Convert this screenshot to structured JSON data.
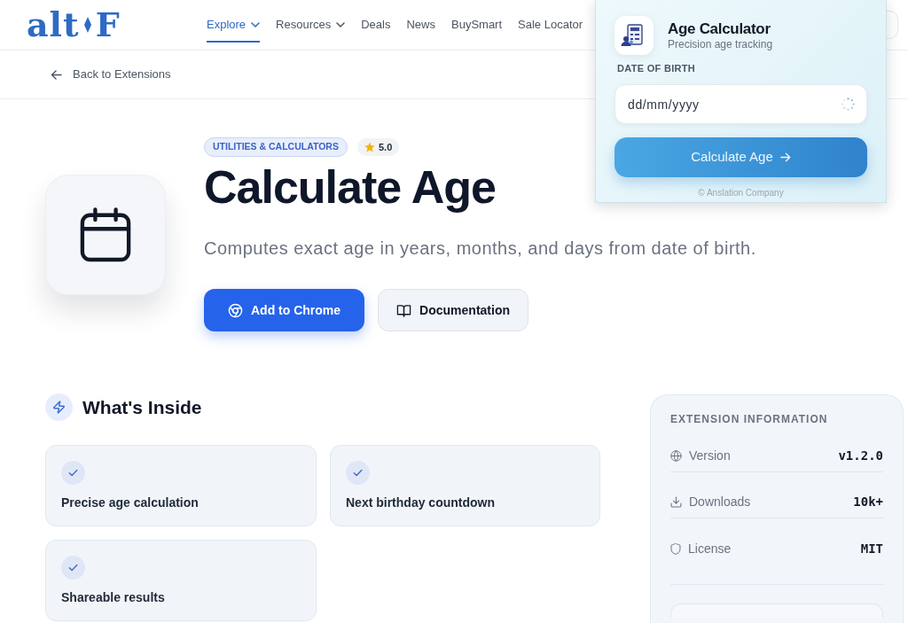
{
  "navbar": {
    "logo": {
      "left": "alt",
      "right": "F"
    },
    "links": [
      {
        "label": "Explore",
        "selected": true,
        "dropdown": true
      },
      {
        "label": "Resources",
        "selected": false,
        "dropdown": true
      },
      {
        "label": "Deals",
        "selected": false,
        "dropdown": false
      },
      {
        "label": "News",
        "selected": false,
        "dropdown": false
      },
      {
        "label": "BuySmart",
        "selected": false,
        "dropdown": false
      },
      {
        "label": "Sale Locator",
        "selected": false,
        "dropdown": false
      }
    ]
  },
  "back_link": "Back to Extensions",
  "extension": {
    "category": "UTILITIES & CALCULATORS",
    "rating": "5.0",
    "title": "Calculate Age",
    "description": "Computes exact age in years, months, and days from date of birth.",
    "buttons": [
      {
        "label": "Add to Chrome",
        "kind": "primary"
      },
      {
        "label": "Documentation",
        "kind": "secondary"
      }
    ]
  },
  "whats_inside": {
    "title": "What's Inside",
    "features": [
      "Precise age calculation",
      "Next birthday countdown",
      "Shareable results"
    ]
  },
  "extension_information": {
    "title": "EXTENSION INFORMATION",
    "rows": [
      {
        "kind": "version",
        "label": "Version",
        "value": "v1.2.0"
      },
      {
        "kind": "downloads",
        "label": "Downloads",
        "value": "10k+"
      },
      {
        "kind": "license",
        "label": "License",
        "value": "MIT"
      }
    ]
  },
  "popup": {
    "title": "Age Calculator",
    "subtitle": "Precision age tracking",
    "field_label": "DATE OF BIRTH",
    "date_field": {
      "placeholder": "dd/mm/yyyy"
    },
    "button": "Calculate Age",
    "footer": "© Anslation Company"
  }
}
